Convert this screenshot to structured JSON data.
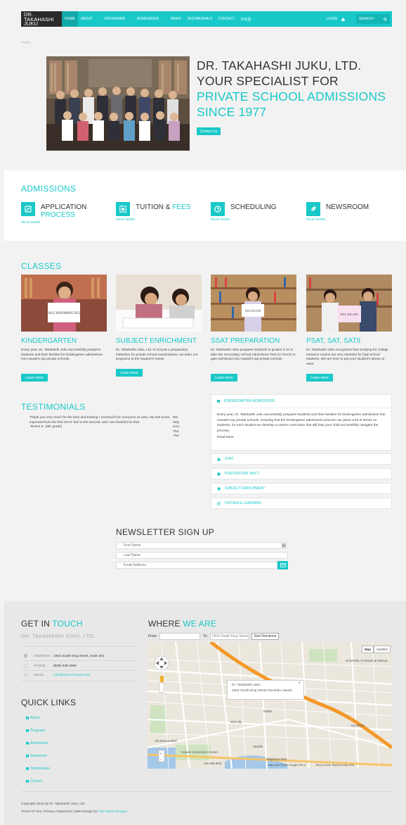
{
  "nav": {
    "logo": [
      "DR.",
      "TAKAHASHI",
      "JUKU"
    ],
    "items": [
      {
        "label": "HOME",
        "dropdown": false
      },
      {
        "label": "ABOUT",
        "dropdown": true
      },
      {
        "label": "PROGRAMS",
        "dropdown": true
      },
      {
        "label": "ADMISSIONS",
        "dropdown": true
      },
      {
        "label": "NEWS",
        "dropdown": false
      },
      {
        "label": "TESTIMONIALS",
        "dropdown": false
      },
      {
        "label": "CONTACT",
        "dropdown": false
      },
      {
        "label": "日本語",
        "dropdown": false
      }
    ],
    "dropdown_marker": "-",
    "login": "LOGIN",
    "search": "SEARCH"
  },
  "breadcrumb": "Home",
  "hero": {
    "line1": "DR. TAKAHASHI JUKU, LTD.",
    "line2": "YOUR SPECIALIST FOR",
    "line3": "PRIVATE SCHOOL ADMISSIONS",
    "line4": "SINCE 1977",
    "button": "Contact Us"
  },
  "admissions": {
    "heading": "ADMISSIONS",
    "readmore": "READ MORE",
    "cards": [
      {
        "title_a": "APPLICATION",
        "title_b": "PROCESS",
        "icon": "edit-icon"
      },
      {
        "title_a": "TUITION & ",
        "title_b": "FEES",
        "icon": "star-icon"
      },
      {
        "title_a": "SCHEDULING",
        "title_b": "",
        "icon": "clock-icon"
      },
      {
        "title_a": "NEWSROOM",
        "title_b": "",
        "icon": "leaf-icon"
      }
    ]
  },
  "classes": {
    "heading": "CLASSES",
    "button": "Learn more",
    "items": [
      {
        "title": "KINDERGARTEN",
        "sign": "2015 HANAHAU'OLI",
        "desc": "Every year, Dr. Takahashi Juku successfully prepares students and their families for kindergarten admissions into Hawaii's top private schools."
      },
      {
        "title": "SUBJECT ENRICHMENT",
        "sign": "",
        "desc": "Dr. Takahashi Juku, Ltd. is not just a preparatory institution for private school examinations, we tailor our programs to the student's needs."
      },
      {
        "title": "SSAT PREPARATION",
        "sign": "2015 IOLANI",
        "desc": "Dr. Takahashi Juku prepares students in grades 2-11 to take the Secondary School Admissions Test (or SSAT) to gain admission into Hawaii's top private schools."
      },
      {
        "title": "PSAT, SAT, SATII",
        "sign": "2012 IOLANI",
        "desc": "Dr. Takahashi Juku recognizes that studying for college entrance exams are very stressful for high school students. We are here to put your student's stress at ease."
      }
    ]
  },
  "testimonials": {
    "heading": "TESTIMONIALS",
    "quote": "Thank you very much for the time and training I received from everyone at Juku.  My test score improved from the first SSAT test to the second, and I am thankful for that.",
    "author": "-Reece K. (6th grade)",
    "peek": [
      "Wa",
      "help",
      "scor",
      "Tha",
      "-Kar"
    ]
  },
  "accordion": {
    "open_title": "KINDERGARTEN ADMISSIONS",
    "open_text": "Every year, Dr. Takahashi Juku successfully prepares students and their families for kindergarten admissions into Hawaii's top private schools. Knowing that the kindergarten admissions process can place a lot of stress on students, for each student we develop a custom curriculum that will help your child successfully navigate the process.",
    "read_more": "Read More",
    "closed": [
      "SSAT",
      "PSAT/SAT/SAT II/ACT",
      "SUBJECT ENRICHMENT",
      "DISTANCE LEARNING"
    ]
  },
  "newsletter": {
    "heading": "NEWSLETTER SIGN UP",
    "first": "First Name",
    "last": "Last Name",
    "email": "Email Address"
  },
  "contact": {
    "heading_a": "GET IN ",
    "heading_b": "TOUCH",
    "company": "DR. TAKAHASHI JUKU, LTD.",
    "address_label": "ADDRESS",
    "address": "2304 South King Street, Suite 201",
    "phone_label": "PHONE",
    "phone": "(808) 946-3366",
    "email_label": "EMAIL",
    "email": "info@juku-in-hawaii.com"
  },
  "where": {
    "heading_a": "WHERE ",
    "heading_b": "WE ARE",
    "from_label": "From:",
    "to_label": "To:",
    "to_value": "2304 South King Street",
    "directions": "Get Directions",
    "map_btn": "Map",
    "sat_btn": "Satellite",
    "popup_title": "Dr. Takahashi Juku",
    "popup_addr": "2304 South King Street Honolulu Hawaii",
    "attribution": "Map data ©2015 Google   200 m",
    "terms": "Terms of Use   Report a map error",
    "labels": [
      "Manoa Valley",
      "University of Hawaii at Manoa",
      "McCully",
      "Moiliili",
      "Waikiki",
      "Kapiolani Blvd",
      "Hawaii Convention Center",
      "Ala Wai Blvd",
      "Kapahulu",
      "Ala Moana Blvd"
    ]
  },
  "quick_links": {
    "heading": "QUICK LINKS",
    "items": [
      "About",
      "Programs",
      "Admissions",
      "Newsroom",
      "Testimonials",
      "Contact"
    ]
  },
  "footer": {
    "copyright": "Copyright 2015 by Dr. Takahashi Juku, Ltd.",
    "terms": "Terms Of Use | Privacy Statement | Web Design by ",
    "designer": "One Wave Designs"
  }
}
